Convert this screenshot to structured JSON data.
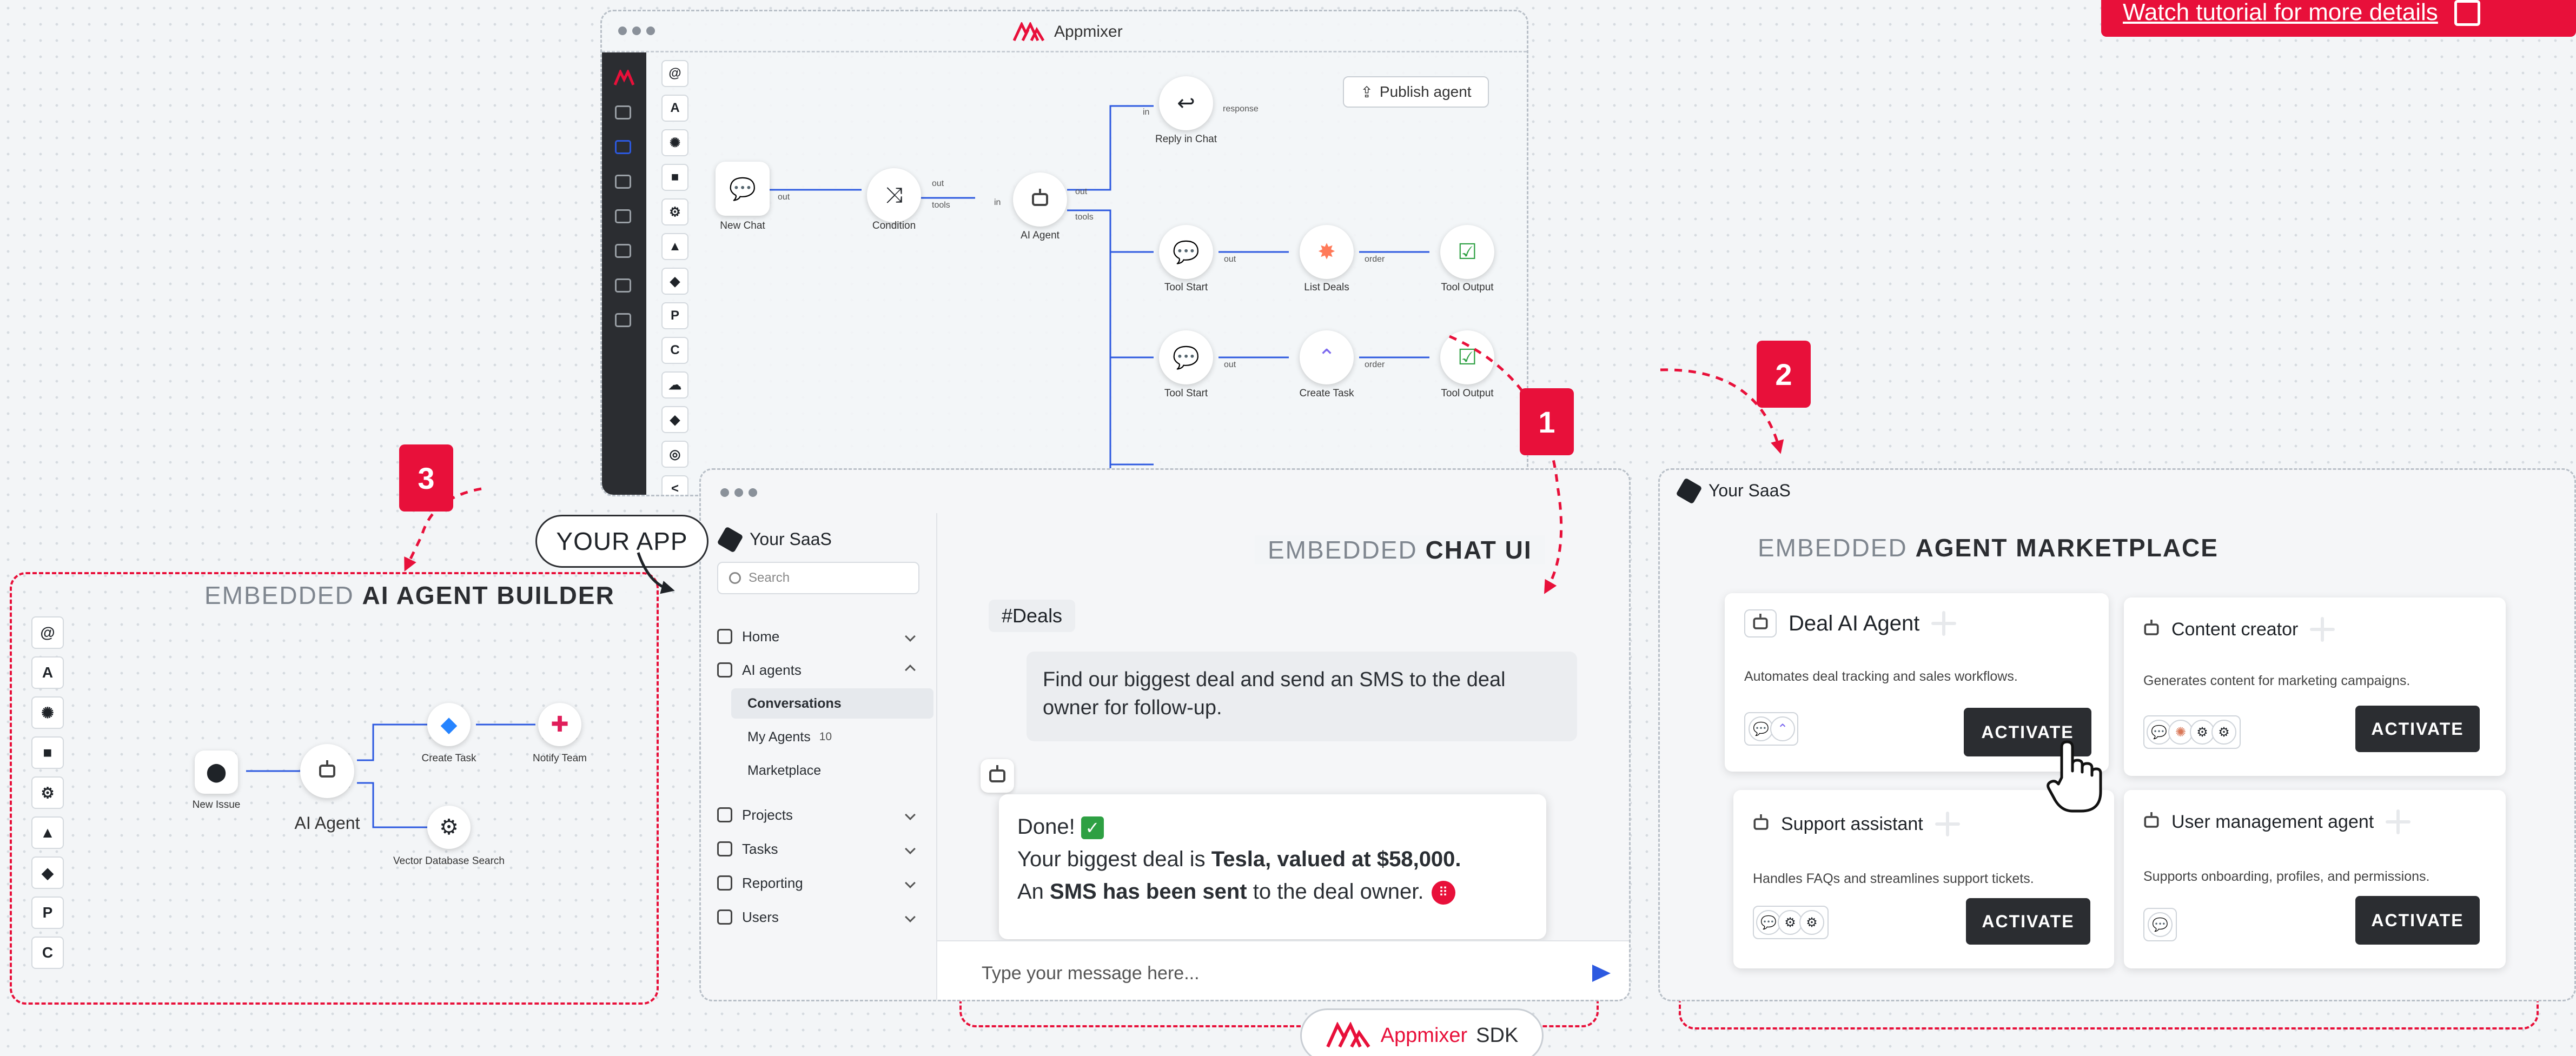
{
  "cta": {
    "label": "Watch tutorial for more details",
    "icon": "external-link-icon"
  },
  "builder": {
    "brand": "Appmixer",
    "publish_label": "Publish agent",
    "nodes": {
      "new_chat": "New Chat",
      "condition": "Condition",
      "ai_agent": "AI Agent",
      "reply_in_chat": "Reply in Chat",
      "tool_start_1": "Tool Start",
      "list_deals": "List Deals",
      "tool_output_1": "Tool Output",
      "tool_start_2": "Tool Start",
      "create_task": "Create Task",
      "tool_output_2": "Tool Output"
    },
    "ports": {
      "out": "out",
      "in": "in",
      "tools": "tools",
      "response": "response",
      "order": "order"
    },
    "strip_icons": [
      "@",
      "A",
      "✺",
      "■",
      "⚙",
      "▲",
      "◆",
      "P",
      "C",
      "☁",
      "◆",
      "◎",
      "<"
    ]
  },
  "markers": {
    "one": "1",
    "two": "2",
    "three": "3"
  },
  "your_app": "YOUR APP",
  "chat_section": {
    "light": "EMBEDDED",
    "dark": "CHAT UI"
  },
  "market_section": {
    "light": "EMBEDDED",
    "dark": "AGENT MARKETPLACE"
  },
  "builder_section": {
    "light": "EMBEDDED",
    "dark": "AI AGENT BUILDER"
  },
  "saas": {
    "brand": "Your SaaS",
    "search_placeholder": "Search",
    "nav": {
      "home": "Home",
      "ai_agents": "AI agents",
      "conversations": "Conversations",
      "my_agents": "My Agents",
      "my_agents_count": "10",
      "marketplace": "Marketplace",
      "projects": "Projects",
      "tasks": "Tasks",
      "reporting": "Reporting",
      "users": "Users"
    }
  },
  "chat": {
    "channel": "#Deals",
    "user_message": "Find our biggest deal and send an SMS to the deal owner for follow-up.",
    "bot": {
      "done": "Done!",
      "line2_a": "Your biggest deal is ",
      "line2_b": "Tesla, valued at $58,000.",
      "line3_a": "An ",
      "line3_b": "SMS has been sent",
      "line3_c": " to the deal owner."
    },
    "composer_placeholder": "Type your message here..."
  },
  "market": {
    "brand": "Your SaaS",
    "agents": [
      {
        "name": "Deal AI Agent",
        "desc": "Automates deal tracking and sales workflows.",
        "button": "ACTIVATE"
      },
      {
        "name": "Content creator",
        "desc": "Generates content for marketing campaigns.",
        "button": "ACTIVATE"
      },
      {
        "name": "Support assistant",
        "desc": "Handles FAQs and streamlines support tickets.",
        "button": "ACTIVATE"
      },
      {
        "name": "User management agent",
        "desc": "Supports onboarding, profiles, and permissions.",
        "button": "ACTIVATE"
      }
    ]
  },
  "emb_builder": {
    "new_issue": "New Issue",
    "ai_agent": "AI Agent",
    "create_task": "Create Task",
    "notify_team": "Notify Team",
    "vector_search": "Vector Database Search",
    "strip_icons": [
      "@",
      "A",
      "✺",
      "■",
      "⚙",
      "▲",
      "◆",
      "P",
      "C"
    ]
  },
  "sdk": {
    "brand": "Appmixer",
    "label": "SDK"
  },
  "colors": {
    "accent": "#e8103a",
    "flow_line": "#2c59e0",
    "dark": "#2b2d31"
  }
}
